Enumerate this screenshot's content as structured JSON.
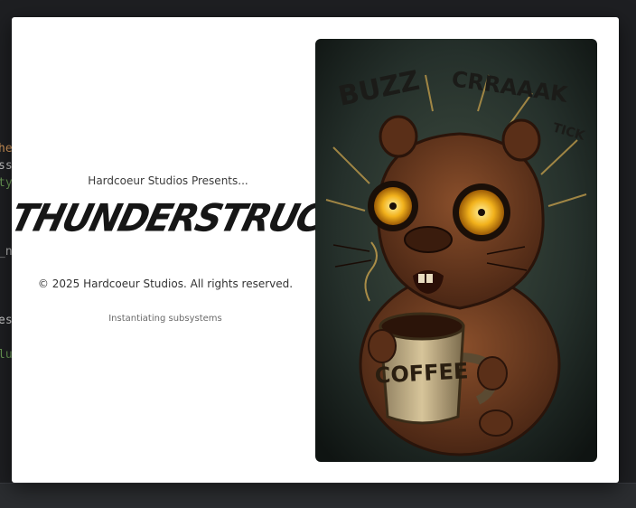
{
  "background": {
    "fragments": [
      "he",
      "ss",
      "ty",
      "_n",
      "es",
      "lu"
    ],
    "colors": [
      "#d7995b",
      "#c8c8c8",
      "#6a9955",
      "#b5b5b5",
      "#d4d4d4",
      "#6a9955"
    ]
  },
  "splash": {
    "presents": "Hardcoeur Studios Presents...",
    "title": "THUNDERSTRUCK",
    "copyright": "© 2025 Hardcoeur Studios. All rights reserved.",
    "status": "Instantiating subsystems",
    "art": {
      "sfx_1": "BUZZ",
      "sfx_2": "CRRAAAK",
      "sfx_3": "TICK",
      "mug_text": "COFFEE"
    }
  },
  "colors": {
    "splash_bg": "#ffffff",
    "editor_bg": "#1e1f22",
    "art_bg": "#1f2a26",
    "fur": "#6b3b21",
    "eyes": "#f2b21c"
  }
}
